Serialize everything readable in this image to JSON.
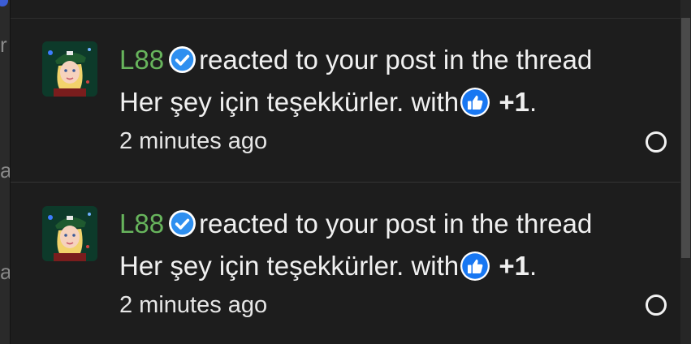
{
  "background_page": {
    "glyphs": [
      "r",
      "a",
      "a"
    ]
  },
  "notifications": [
    {
      "username": "L88",
      "action_text": "reacted to your post in the thread",
      "thread_title": "Her şey için teşekkürler.",
      "with_text": "with",
      "reaction_label": "+1",
      "trailing": ".",
      "time": "2 minutes ago"
    },
    {
      "username": "L88",
      "action_text": "reacted to your post in the thread",
      "thread_title": "Her şey için teşekkürler.",
      "with_text": "with",
      "reaction_label": "+1",
      "trailing": ".",
      "time": "2 minutes ago"
    }
  ],
  "icons": {
    "verified": "verified-badge-icon",
    "reaction": "thumbs-up-icon",
    "mark_read": "circle-outline-icon"
  },
  "colors": {
    "username": "#67b45c",
    "verified_badge": "#2e8ff0",
    "panel_bg": "#1d1d1d"
  }
}
